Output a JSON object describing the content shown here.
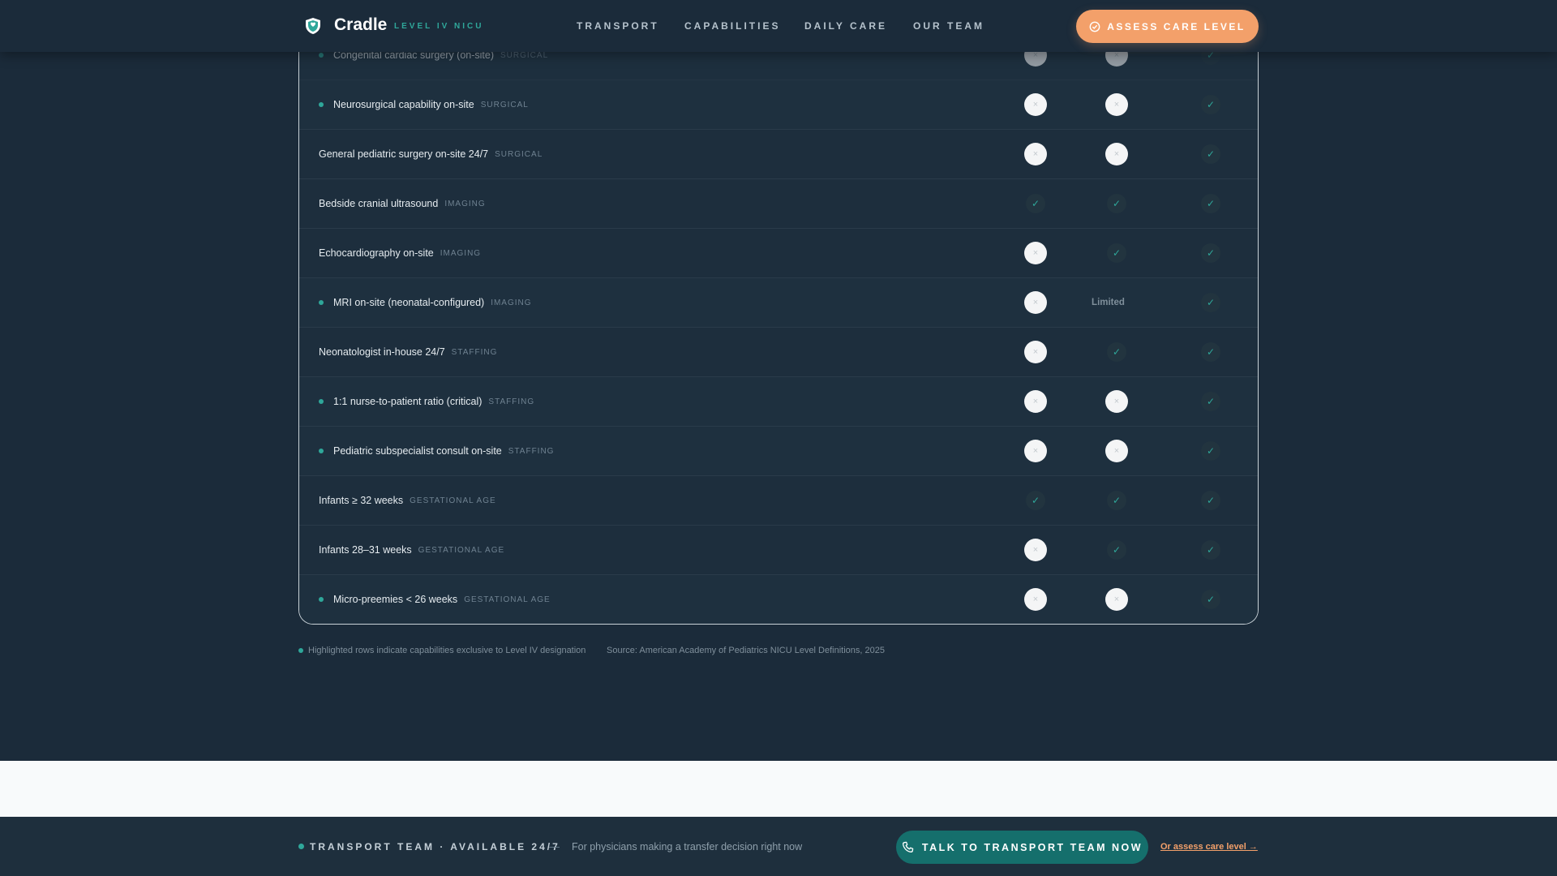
{
  "header": {
    "brand": "Cradle",
    "tagline": "LEVEL IV NICU",
    "nav": [
      "TRANSPORT",
      "CAPABILITIES",
      "DAILY CARE",
      "OUR TEAM"
    ],
    "cta_label": "ASSESS CARE LEVEL",
    "logo_icon": "shield-icon"
  },
  "colors": {
    "background": "#1b2b3a",
    "accent_teal": "#2fa79a",
    "accent_orange": "#f3a06a",
    "button_teal": "#156f6c"
  },
  "table": {
    "rows": [
      {
        "label": "Congenital cardiac surgery (on-site)",
        "category": "SURGICAL",
        "exclusive": true,
        "c1": "no",
        "c2": "no",
        "c3": "yes",
        "faded": true
      },
      {
        "label": "Neurosurgical capability on-site",
        "category": "SURGICAL",
        "exclusive": true,
        "c1": "no",
        "c2": "no",
        "c3": "yes"
      },
      {
        "label": "General pediatric surgery on-site 24/7",
        "category": "SURGICAL",
        "exclusive": false,
        "c1": "no",
        "c2": "no",
        "c3": "yes"
      },
      {
        "label": "Bedside cranial ultrasound",
        "category": "IMAGING",
        "exclusive": false,
        "c1": "yes",
        "c2": "yes",
        "c3": "yes"
      },
      {
        "label": "Echocardiography on-site",
        "category": "IMAGING",
        "exclusive": false,
        "c1": "no",
        "c2": "yes",
        "c3": "yes"
      },
      {
        "label": "MRI on-site (neonatal-configured)",
        "category": "IMAGING",
        "exclusive": true,
        "c1": "no",
        "c2": "Limited",
        "c3": "yes"
      },
      {
        "label": "Neonatologist in-house 24/7",
        "category": "STAFFING",
        "exclusive": false,
        "c1": "no",
        "c2": "yes",
        "c3": "yes"
      },
      {
        "label": "1:1 nurse-to-patient ratio (critical)",
        "category": "STAFFING",
        "exclusive": true,
        "c1": "no",
        "c2": "no",
        "c3": "yes"
      },
      {
        "label": "Pediatric subspecialist consult on-site",
        "category": "STAFFING",
        "exclusive": true,
        "c1": "no",
        "c2": "no",
        "c3": "yes"
      },
      {
        "label": "Infants ≥ 32 weeks",
        "category": "GESTATIONAL AGE",
        "exclusive": false,
        "c1": "yes",
        "c2": "yes",
        "c3": "yes"
      },
      {
        "label": "Infants 28–31 weeks",
        "category": "GESTATIONAL AGE",
        "exclusive": false,
        "c1": "no",
        "c2": "yes",
        "c3": "yes"
      },
      {
        "label": "Micro-preemies < 26 weeks",
        "category": "GESTATIONAL AGE",
        "exclusive": true,
        "c1": "no",
        "c2": "no",
        "c3": "yes"
      }
    ]
  },
  "legend": {
    "highlight_note": "Highlighted rows indicate capabilities exclusive to Level IV designation",
    "source": "Source: American Academy of Pediatrics NICU Level Definitions, 2025"
  },
  "bottom_bar": {
    "title": "TRANSPORT TEAM · AVAILABLE 24/7",
    "dash": "—",
    "note": "For physicians making a transfer decision right now",
    "button_label": "TALK TO TRANSPORT TEAM NOW",
    "link_label": "Or assess care level →"
  }
}
